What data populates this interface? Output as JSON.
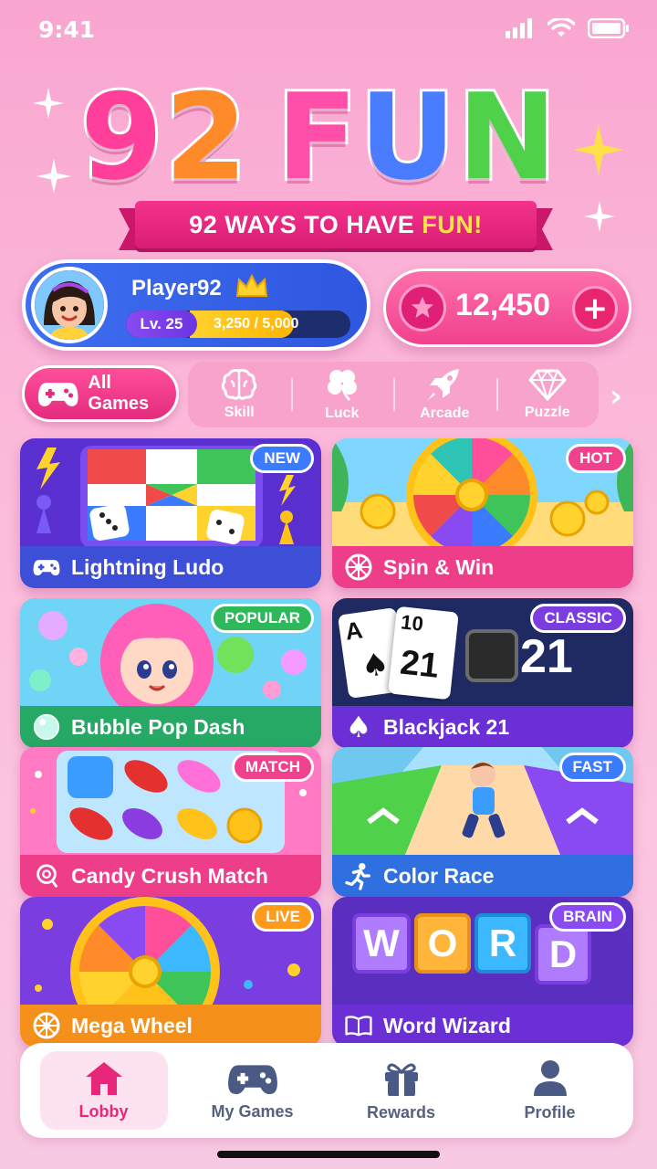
{
  "status": {
    "time": "9:41"
  },
  "logo": {
    "text": "92 FUN",
    "tagline_main": "92 WAYS TO HAVE ",
    "tagline_highlight": "FUN!"
  },
  "player": {
    "name": "Player92",
    "level_label": "Lv. 25",
    "xp_text": "3,250 / 5,000",
    "xp_progress": 0.65
  },
  "coins": {
    "value": "12,450",
    "add_label": "+"
  },
  "filters": {
    "all_label": "All Games",
    "categories": [
      {
        "label": "Skill",
        "icon": "brain-icon"
      },
      {
        "label": "Luck",
        "icon": "clover-icon"
      },
      {
        "label": "Arcade",
        "icon": "rocket-icon"
      },
      {
        "label": "Puzzle",
        "icon": "diamond-icon"
      }
    ]
  },
  "games": [
    {
      "title": "Lightning Ludo",
      "badge": "NEW",
      "icon": "gamepad-icon"
    },
    {
      "title": "Spin & Win",
      "badge": "HOT",
      "icon": "wheel-icon"
    },
    {
      "title": "Bubble Pop Dash",
      "badge": "POPULAR",
      "icon": "bubble-icon"
    },
    {
      "title": "Blackjack 21",
      "badge": "CLASSIC",
      "icon": "spade-icon",
      "art_text_left": "A",
      "art_text_card": "10",
      "art_text_sum": "21"
    },
    {
      "title": "Candy Crush Match",
      "badge": "MATCH",
      "icon": "candy-icon"
    },
    {
      "title": "Color Race",
      "badge": "FAST",
      "icon": "runner-icon"
    },
    {
      "title": "Mega Wheel",
      "badge": "LIVE",
      "icon": "wheel-icon"
    },
    {
      "title": "Word Wizard",
      "badge": "BRAIN",
      "icon": "book-icon",
      "art_letters": [
        "W",
        "O",
        "R",
        "D"
      ]
    }
  ],
  "nav": [
    {
      "label": "Lobby",
      "icon": "home-icon",
      "active": true
    },
    {
      "label": "My Games",
      "icon": "gamepad-icon",
      "active": false
    },
    {
      "label": "Rewards",
      "icon": "gift-icon",
      "active": false
    },
    {
      "label": "Profile",
      "icon": "person-icon",
      "active": false
    }
  ],
  "colors": {
    "accent": "#e8267a",
    "player_card": "#3d6ff0",
    "coin_card": "#f0418d",
    "level_fill": "#ffc21a"
  }
}
